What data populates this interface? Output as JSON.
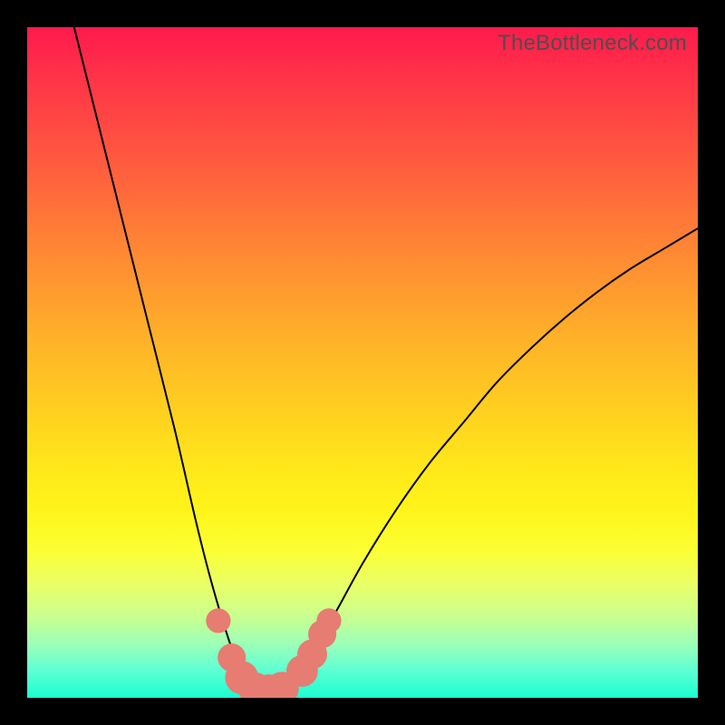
{
  "watermark": "TheBottleneck.com",
  "colors": {
    "frame": "#000000",
    "marker": "#e77c72",
    "curve": "#000000",
    "gradient_top": "#ff1a4d",
    "gradient_bottom": "#1affd0"
  },
  "chart_data": {
    "type": "line",
    "title": "",
    "xlabel": "",
    "ylabel": "",
    "xlim": [
      0,
      100
    ],
    "ylim": [
      0,
      100
    ],
    "grid": false,
    "legend": false,
    "series": [
      {
        "name": "bottleneck-curve",
        "x": [
          7,
          10,
          14,
          18,
          22,
          25,
          27,
          29,
          31,
          32.5,
          34,
          36,
          38,
          40,
          45,
          50,
          55,
          60,
          65,
          70,
          75,
          80,
          85,
          90,
          95,
          100
        ],
        "y": [
          100,
          88,
          72,
          56,
          40,
          27,
          19,
          12,
          6,
          3,
          1.5,
          1,
          1.3,
          3,
          11,
          20,
          28,
          35,
          41,
          47,
          52,
          56.5,
          60.5,
          64,
          67,
          70
        ]
      }
    ],
    "markers": [
      {
        "x": 28.5,
        "y": 11.5,
        "r": 1.0
      },
      {
        "x": 30.5,
        "y": 6.0,
        "r": 1.2
      },
      {
        "x": 32.0,
        "y": 3.0,
        "r": 1.5
      },
      {
        "x": 34.0,
        "y": 1.3,
        "r": 1.5
      },
      {
        "x": 36.0,
        "y": 1.0,
        "r": 1.5
      },
      {
        "x": 38.0,
        "y": 1.4,
        "r": 1.5
      },
      {
        "x": 41.0,
        "y": 4.0,
        "r": 1.4
      },
      {
        "x": 42.5,
        "y": 6.5,
        "r": 1.3
      },
      {
        "x": 44.0,
        "y": 9.5,
        "r": 1.2
      },
      {
        "x": 45.0,
        "y": 11.5,
        "r": 1.0
      }
    ]
  }
}
